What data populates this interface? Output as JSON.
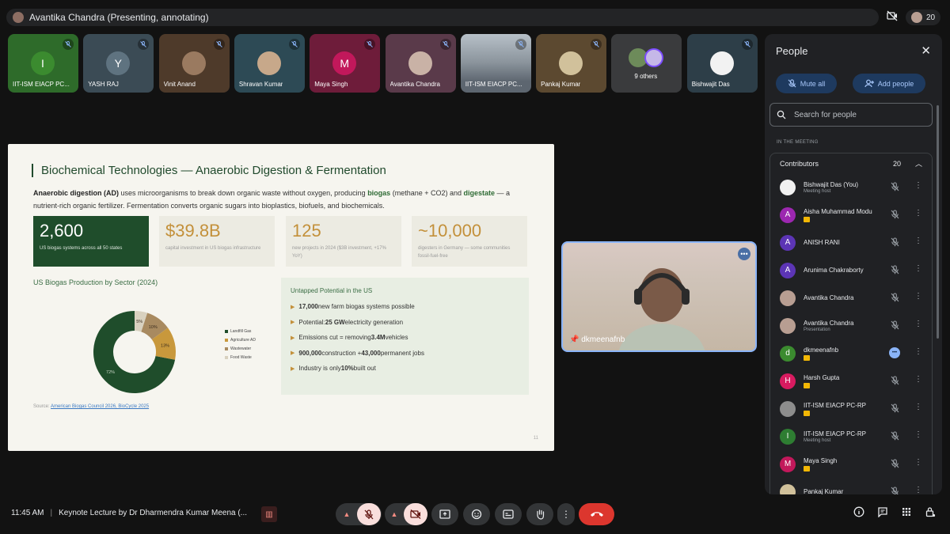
{
  "presenter_bar": {
    "text": "Avantika Chandra (Presenting, annotating)"
  },
  "participant_count": "20",
  "tiles": [
    {
      "name": "IIT-ISM EIACP PC...",
      "initial": "I",
      "bg": "#2e6b2a",
      "circle": "#3b8b2f"
    },
    {
      "name": "YASH RAJ",
      "initial": "Y",
      "bg": "#3b4b55",
      "circle": "#5f7380"
    },
    {
      "name": "Vinit Anand",
      "initial": "",
      "bg": "#4e3a2a",
      "circle": "#9a7a60"
    },
    {
      "name": "Shravan Kumar",
      "initial": "",
      "bg": "#2d4a55",
      "circle": "#c7a88a"
    },
    {
      "name": "Maya Singh",
      "initial": "M",
      "bg": "#6e1c3a",
      "circle": "#c2185b"
    },
    {
      "name": "Avantika Chandra",
      "initial": "",
      "bg": "#5a3a4a",
      "circle": "#c9b2a6"
    },
    {
      "name": "IIT-ISM EIACP PC...",
      "initial": "",
      "bg": "#5d6670",
      "circle": ""
    },
    {
      "name": "Pankaj Kumar",
      "initial": "",
      "bg": "#5c4930",
      "circle": "#d1c19b"
    },
    {
      "name": "9 others",
      "initial": "",
      "bg": "#3a3b3d",
      "circle": ""
    },
    {
      "name": "Bishwajit Das",
      "initial": "",
      "bg": "#2d3e48",
      "circle": "#f2f2f2"
    }
  ],
  "slide": {
    "title": "Biochemical Technologies — Anaerobic Digestion & Fermentation",
    "intro_bold": "Anaerobic digestion (AD)",
    "intro_1": " uses microorganisms to break down organic waste without oxygen, producing ",
    "intro_biogas": "biogas",
    "intro_2": " (methane + CO2) and ",
    "intro_digestate": "digestate",
    "intro_3": " — a nutrient-rich organic fertilizer. Fermentation converts organic sugars into bioplastics, biofuels, and biochemicals.",
    "stats": [
      {
        "big": "2,600",
        "small": "US biogas systems across all 50 states"
      },
      {
        "big": "$39.8B",
        "small": "capital investment in US biogas infrastructure"
      },
      {
        "big": "125",
        "small": "new projects in 2024 ($3B investment, +17% YoY)"
      },
      {
        "big": "~10,000",
        "small": "digesters in Germany — some communities fossil-fuel-free"
      }
    ],
    "chart_title": "US Biogas Production by Sector (2024)",
    "potential_title": "Untapped Potential in the US",
    "potential": [
      {
        "bold": "17,000",
        "text": " new farm biogas systems possible"
      },
      {
        "pre": "Potential: ",
        "bold": "25 GW",
        "text": " electricity generation"
      },
      {
        "pre": "Emissions cut = removing ",
        "bold": "3.4M",
        "text": " vehicles"
      },
      {
        "bold": "900,000",
        "text": " construction + ",
        "bold2": "43,000",
        "text2": " permanent jobs"
      },
      {
        "pre": "Industry is only ",
        "bold": "10%",
        "text": " built out"
      }
    ],
    "source_label": "Source: ",
    "source_link": "American Biogas Council 2026, BioCycle 2025",
    "number": "11"
  },
  "chart_data": {
    "type": "pie",
    "title": "US Biogas Production by Sector (2024)",
    "categories": [
      "Landfill Gas",
      "Agriculture AD",
      "Wastewater",
      "Food Waste"
    ],
    "values": [
      72,
      13,
      10,
      5
    ],
    "colors": [
      "#1f4d2b",
      "#c8983c",
      "#a88a60",
      "#d8d1bf"
    ],
    "donut": true
  },
  "speaker": {
    "name": "dkmeenafnb"
  },
  "people": {
    "title": "People",
    "mute_all": "Mute all",
    "add_people": "Add people",
    "search_placeholder": "Search for people",
    "in_meeting": "IN THE MEETING",
    "group": "Contributors",
    "group_count": "20",
    "list": [
      {
        "name": "Bishwajit Das (You)",
        "sub": "Meeting host",
        "initial": "",
        "color": "#f1f1f1",
        "badge": false
      },
      {
        "name": "Aisha Muhammad Modu",
        "sub": "",
        "initial": "A",
        "color": "#9c27b0",
        "badge": true
      },
      {
        "name": "ANISH RANI",
        "sub": "",
        "initial": "A",
        "color": "#5c35b5",
        "badge": false
      },
      {
        "name": "Arunima Chakraborty",
        "sub": "",
        "initial": "A",
        "color": "#5c35b5",
        "badge": false
      },
      {
        "name": "Avantika Chandra",
        "sub": "",
        "initial": "",
        "color": "#b89e92",
        "badge": false
      },
      {
        "name": "Avantika Chandra",
        "sub": "Presentation",
        "initial": "",
        "color": "#b89e92",
        "badge": false
      },
      {
        "name": "dkmeenafnb",
        "sub": "",
        "initial": "d",
        "color": "#3b8b2f",
        "badge": true
      },
      {
        "name": "Harsh Gupta",
        "sub": "",
        "initial": "H",
        "color": "#d81b60",
        "badge": true
      },
      {
        "name": "IIT-ISM EIACP PC-RP",
        "sub": "",
        "initial": "",
        "color": "#8d8d8d",
        "badge": true
      },
      {
        "name": "IIT-ISM EIACP PC-RP",
        "sub": "Meeting host",
        "initial": "I",
        "color": "#2e7d32",
        "badge": false
      },
      {
        "name": "Maya Singh",
        "sub": "",
        "initial": "M",
        "color": "#c2185b",
        "badge": true
      },
      {
        "name": "Pankaj Kumar",
        "sub": "",
        "initial": "",
        "color": "#d1c19b",
        "badge": false
      }
    ]
  },
  "bottom": {
    "time": "11:45 AM",
    "sep": "|",
    "meeting_title": "Keynote Lecture by Dr Dharmendra Kumar Meena (..."
  }
}
